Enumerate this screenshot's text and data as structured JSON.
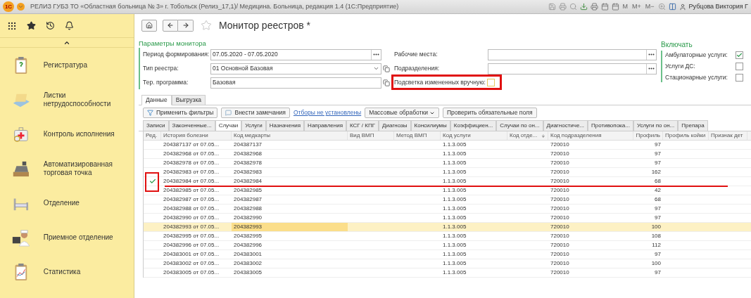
{
  "titlebar": {
    "logo": "1С",
    "title": "РЕЛИЗ ГУБЗ ТО «Областная больница № 3» г. Тобольск (Релиз_17,1)/ Медицина. Больница, редакция 1.4  (1С:Предприятие)",
    "memory_buttons": [
      "M",
      "M+",
      "M−"
    ],
    "user": "Рубцова Виктория Г"
  },
  "sidebar": {
    "items": [
      {
        "label": "Регистратура",
        "kind": "clipboard"
      },
      {
        "label": "Листки нетрудоспособности",
        "kind": "document"
      },
      {
        "label": "Контроль исполнения",
        "kind": "medkit"
      },
      {
        "label": "Автоматизированная торговая точка",
        "kind": "register"
      },
      {
        "label": "Отделение",
        "kind": "bed"
      },
      {
        "label": "Приемное отделение",
        "kind": "doctor"
      },
      {
        "label": "Статистика",
        "kind": "chart"
      }
    ]
  },
  "header": {
    "title": "Монитор реестров *",
    "favorite": false
  },
  "params": {
    "title": "Параметры монитора",
    "left": [
      {
        "label": "Период формирования:",
        "value": "07.05.2020 - 07.05.2020",
        "kind": "choice"
      },
      {
        "label": "Тип реестра:",
        "value": "01 Основной Базовая",
        "kind": "dropdown"
      },
      {
        "label": "Тер. программа:",
        "value": "Базовая",
        "kind": "open"
      }
    ],
    "middle": [
      {
        "label": "Рабочие места:",
        "kind": "choice"
      },
      {
        "label": "Подразделения:",
        "kind": "choice"
      },
      {
        "label": "Подсветка измененных вручную:",
        "kind": "checkbox",
        "checked": false,
        "annotated": true
      }
    ]
  },
  "include": {
    "title": "Включать",
    "options": [
      {
        "label": "Амбулаторные услуги:",
        "checked": true
      },
      {
        "label": "Услуги ДС:",
        "checked": false
      },
      {
        "label": "Стационарные услуги:",
        "checked": false
      }
    ]
  },
  "tabs": [
    {
      "label": "Данные",
      "selected": true
    },
    {
      "label": "Выгрузка",
      "selected": false
    }
  ],
  "toolbar": [
    {
      "label": "Применить фильтры",
      "kind": "filter"
    },
    {
      "label": "Внести замечания",
      "kind": "comment"
    },
    {
      "label": "Отборы не установлены",
      "kind": "link"
    },
    {
      "label": "Массовые обработки",
      "kind": "menu"
    },
    {
      "label": "Проверить обязательные поля",
      "kind": "button"
    }
  ],
  "subtabs": [
    {
      "label": "Записи",
      "selected": false
    },
    {
      "label": "Законченные...",
      "selected": false
    },
    {
      "label": "Случаи",
      "selected": true
    },
    {
      "label": "Услуги",
      "selected": false
    },
    {
      "label": "Назначения",
      "selected": false
    },
    {
      "label": "Направления",
      "selected": false
    },
    {
      "label": "КСГ / КПГ",
      "selected": false
    },
    {
      "label": "Диагнозы",
      "selected": false
    },
    {
      "label": "Консилиумы",
      "selected": false
    },
    {
      "label": "Коэффициен...",
      "selected": false
    },
    {
      "label": "Случаи по он...",
      "selected": false
    },
    {
      "label": "Диагностиче...",
      "selected": false
    },
    {
      "label": "Противопока...",
      "selected": false
    },
    {
      "label": "Услуги по он...",
      "selected": false
    },
    {
      "label": "Препара",
      "selected": false
    }
  ],
  "table": {
    "columns": [
      {
        "label": "Ред."
      },
      {
        "label": "История болезни"
      },
      {
        "label": "Код медкарты"
      },
      {
        "label": "Вид ВМП"
      },
      {
        "label": "Метод ВМП"
      },
      {
        "label": "Код услуги"
      },
      {
        "label": "Код отде...",
        "sorted": true
      },
      {
        "label": "Код подразделения"
      },
      {
        "label": "Профиль"
      },
      {
        "label": "Профиль койки"
      },
      {
        "label": "Признак дет"
      }
    ],
    "rows": [
      {
        "edited": false,
        "selected": false,
        "annotated": false,
        "history": "204387137 от 07.05...",
        "card": "204387137",
        "service": "1.1.3.005",
        "division": "720010",
        "profile": "97"
      },
      {
        "edited": false,
        "selected": false,
        "annotated": false,
        "history": "204382968 от 07.05...",
        "card": "204382968",
        "service": "1.1.3.005",
        "division": "720010",
        "profile": "97"
      },
      {
        "edited": false,
        "selected": false,
        "annotated": false,
        "history": "204382978 от 07.05...",
        "card": "204382978",
        "service": "1.1.3.005",
        "division": "720010",
        "profile": "97"
      },
      {
        "edited": false,
        "selected": false,
        "annotated": false,
        "history": "204382983 от 07.05...",
        "card": "204382983",
        "service": "1.1.3.005",
        "division": "720010",
        "profile": "162"
      },
      {
        "edited": true,
        "selected": false,
        "annotated": true,
        "history": "204382984 от 07.05...",
        "card": "204382984",
        "service": "1.1.3.005",
        "division": "720010",
        "profile": "68"
      },
      {
        "edited": false,
        "selected": false,
        "annotated": false,
        "history": "204382985 от 07.05...",
        "card": "204382985",
        "service": "1.1.3.005",
        "division": "720010",
        "profile": "42"
      },
      {
        "edited": false,
        "selected": false,
        "annotated": false,
        "history": "204382987 от 07.05...",
        "card": "204382987",
        "service": "1.1.3.005",
        "division": "720010",
        "profile": "68"
      },
      {
        "edited": false,
        "selected": false,
        "annotated": false,
        "history": "204382988 от 07.05...",
        "card": "204382988",
        "service": "1.1.3.005",
        "division": "720010",
        "profile": "97"
      },
      {
        "edited": false,
        "selected": false,
        "annotated": false,
        "history": "204382990 от 07.05...",
        "card": "204382990",
        "service": "1.1.3.005",
        "division": "720010",
        "profile": "97"
      },
      {
        "edited": false,
        "selected": true,
        "annotated": false,
        "history": "204382993 от 07.05...",
        "card": "204382993",
        "service": "1.1.3.005",
        "division": "720010",
        "profile": "100"
      },
      {
        "edited": false,
        "selected": false,
        "annotated": false,
        "history": "204382995 от 07.05...",
        "card": "204382995",
        "service": "1.1.3.005",
        "division": "720010",
        "profile": "108"
      },
      {
        "edited": false,
        "selected": false,
        "annotated": false,
        "history": "204382996 от 07.05...",
        "card": "204382996",
        "service": "1.1.3.005",
        "division": "720010",
        "profile": "112"
      },
      {
        "edited": false,
        "selected": false,
        "annotated": false,
        "history": "204383001 от 07.05...",
        "card": "204383001",
        "service": "1.1.3.005",
        "division": "720010",
        "profile": "97"
      },
      {
        "edited": false,
        "selected": false,
        "annotated": false,
        "history": "204383002 от 07.05...",
        "card": "204383002",
        "service": "1.1.3.005",
        "division": "720010",
        "profile": "100"
      },
      {
        "edited": false,
        "selected": false,
        "annotated": false,
        "history": "204383005 от 07.05...",
        "card": "204383005",
        "service": "1.1.3.005",
        "division": "720010",
        "profile": "97"
      }
    ]
  }
}
